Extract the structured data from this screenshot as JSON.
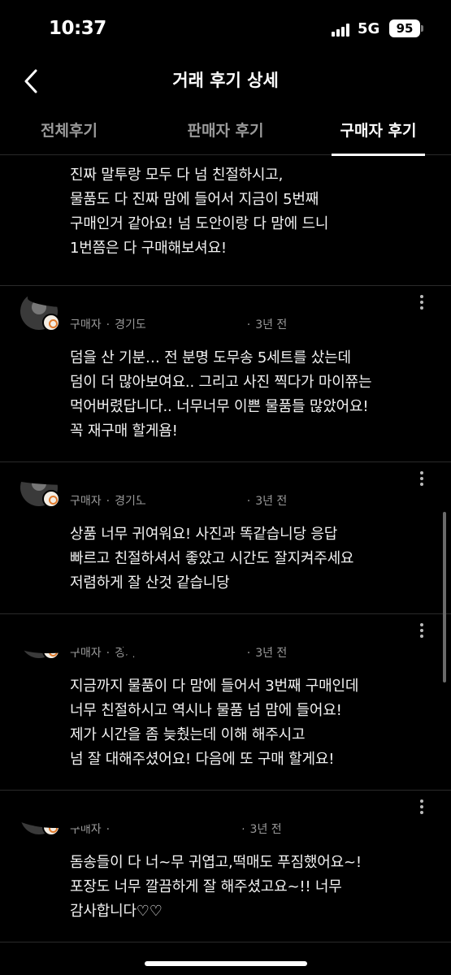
{
  "status_bar": {
    "time": "10:37",
    "network": "5G",
    "battery": "95"
  },
  "header": {
    "title": "거래 후기 상세"
  },
  "tabs": [
    {
      "label": "전체후기",
      "active": false
    },
    {
      "label": "판매자 후기",
      "active": false
    },
    {
      "label": "구매자 후기",
      "active": true
    }
  ],
  "reviews": [
    {
      "text": "진짜 말투랑 모두 다 넘 친절하시고,\n물품도 다 진짜 맘에 들어서 지금이 5번째\n구매인거 같아요! 넘 도안이랑 다 맘에 드니\n1번쯤은 다 구매해보셔요!"
    },
    {
      "role": "구매자",
      "location": "경기도",
      "time": "3년 전",
      "text": "덤을 산 기분… 전 분명 도무송 5세트를 샀는데\n덤이 더 많아보여요.. 그리고 사진 찍다가 마이쮸는\n먹어버렸답니다.. 너무너무 이쁜 물품들 많았어요!\n꼭 재구매 할게욤!"
    },
    {
      "role": "구매자",
      "location": "경기도",
      "time": "3년 전",
      "text": "상품 너무 귀여워요! 사진과 똑같습니당 응답\n빠르고 친절하셔서 좋았고 시간도 잘지켜주세요\n저렴하게 잘 산것 같습니당"
    },
    {
      "role": "구매자",
      "location": "경기도",
      "time": "3년 전",
      "text": "지금까지 물품이 다 맘에 들어서 3번째 구매인데\n너무 친절하시고 역시나 물품 넘 맘에 들어요!\n제가 시간을 좀 늦췄는데 이해 해주시고\n넘 잘 대해주셨어요! 다음에 또 구매 할게요!"
    },
    {
      "role": "구매자",
      "location": "",
      "time": "3년 전",
      "text": "돔송들이 다 너~무 귀엽고,떡매도 푸짐했어요~!\n포장도 너무 깔끔하게 잘 해주셨고요~!! 너무\n감사합니다♡♡"
    }
  ]
}
